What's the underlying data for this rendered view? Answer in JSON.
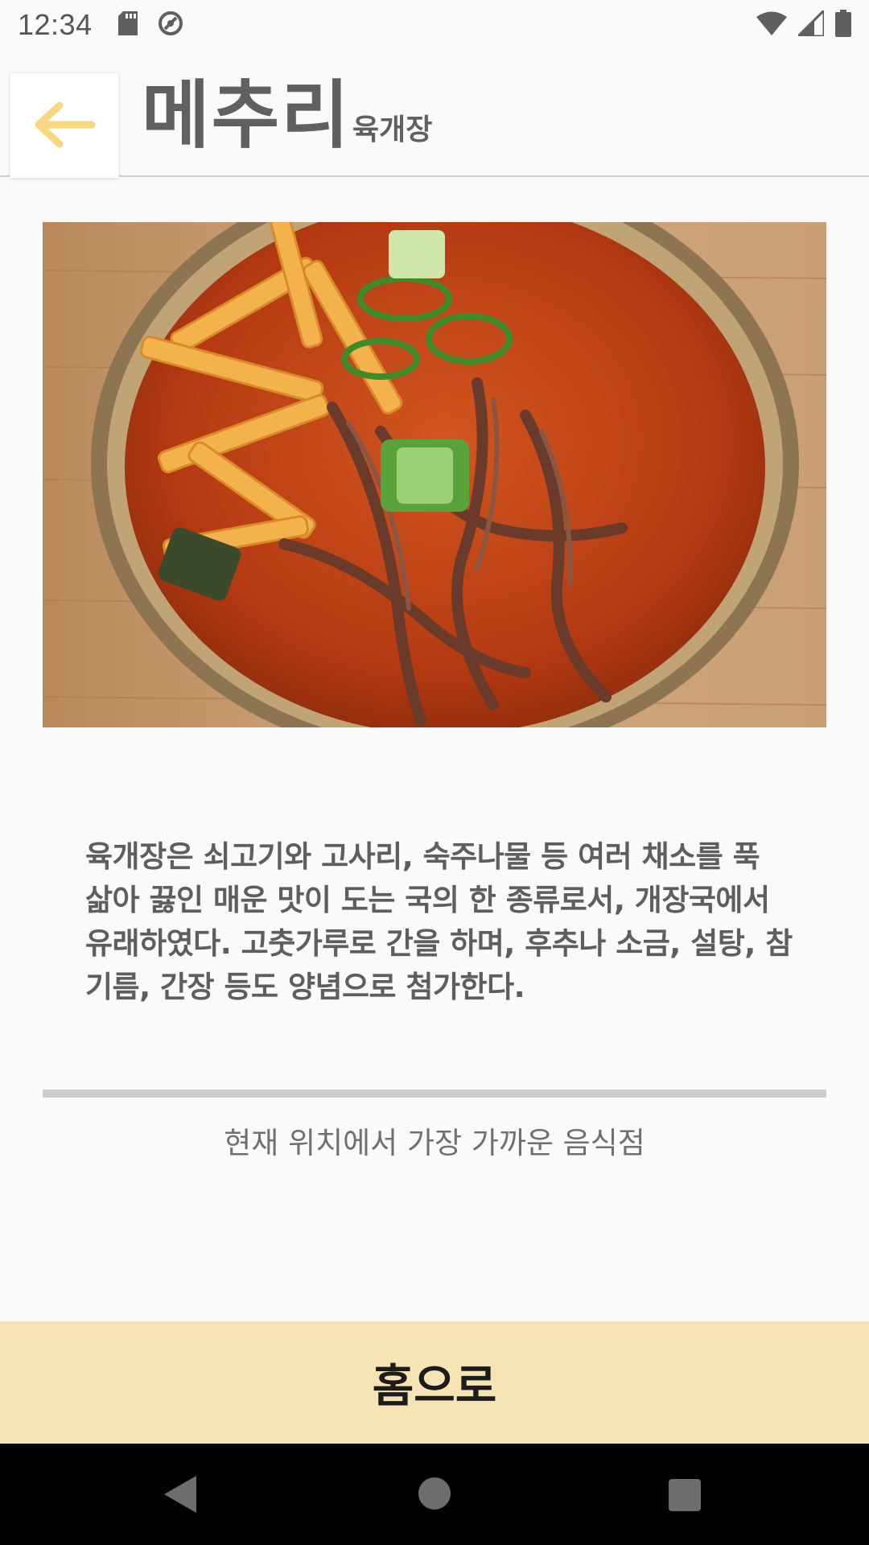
{
  "status_bar": {
    "time": "12:34"
  },
  "header": {
    "app_title": "메추리",
    "food_name": "육개장",
    "back_icon": "arrow-left-icon",
    "accent_color": "#f9d77e"
  },
  "photo": {
    "description_icon": "food-photo"
  },
  "description": {
    "text": "육개장은 쇠고기와 고사리, 숙주나물 등 여러 채소를 푹 삶아 끓인 매운 맛이 도는 국의 한 종류로서, 개장국에서 유래하였다. 고춧가루로 간을 하며, 후추나 소금, 설탕, 참기름, 간장 등도 양념으로 첨가한다."
  },
  "nearest": {
    "label": "현재 위치에서 가장 가까운 음식점"
  },
  "home_button": {
    "label": "홈으로",
    "color": "#f6e4b5"
  }
}
